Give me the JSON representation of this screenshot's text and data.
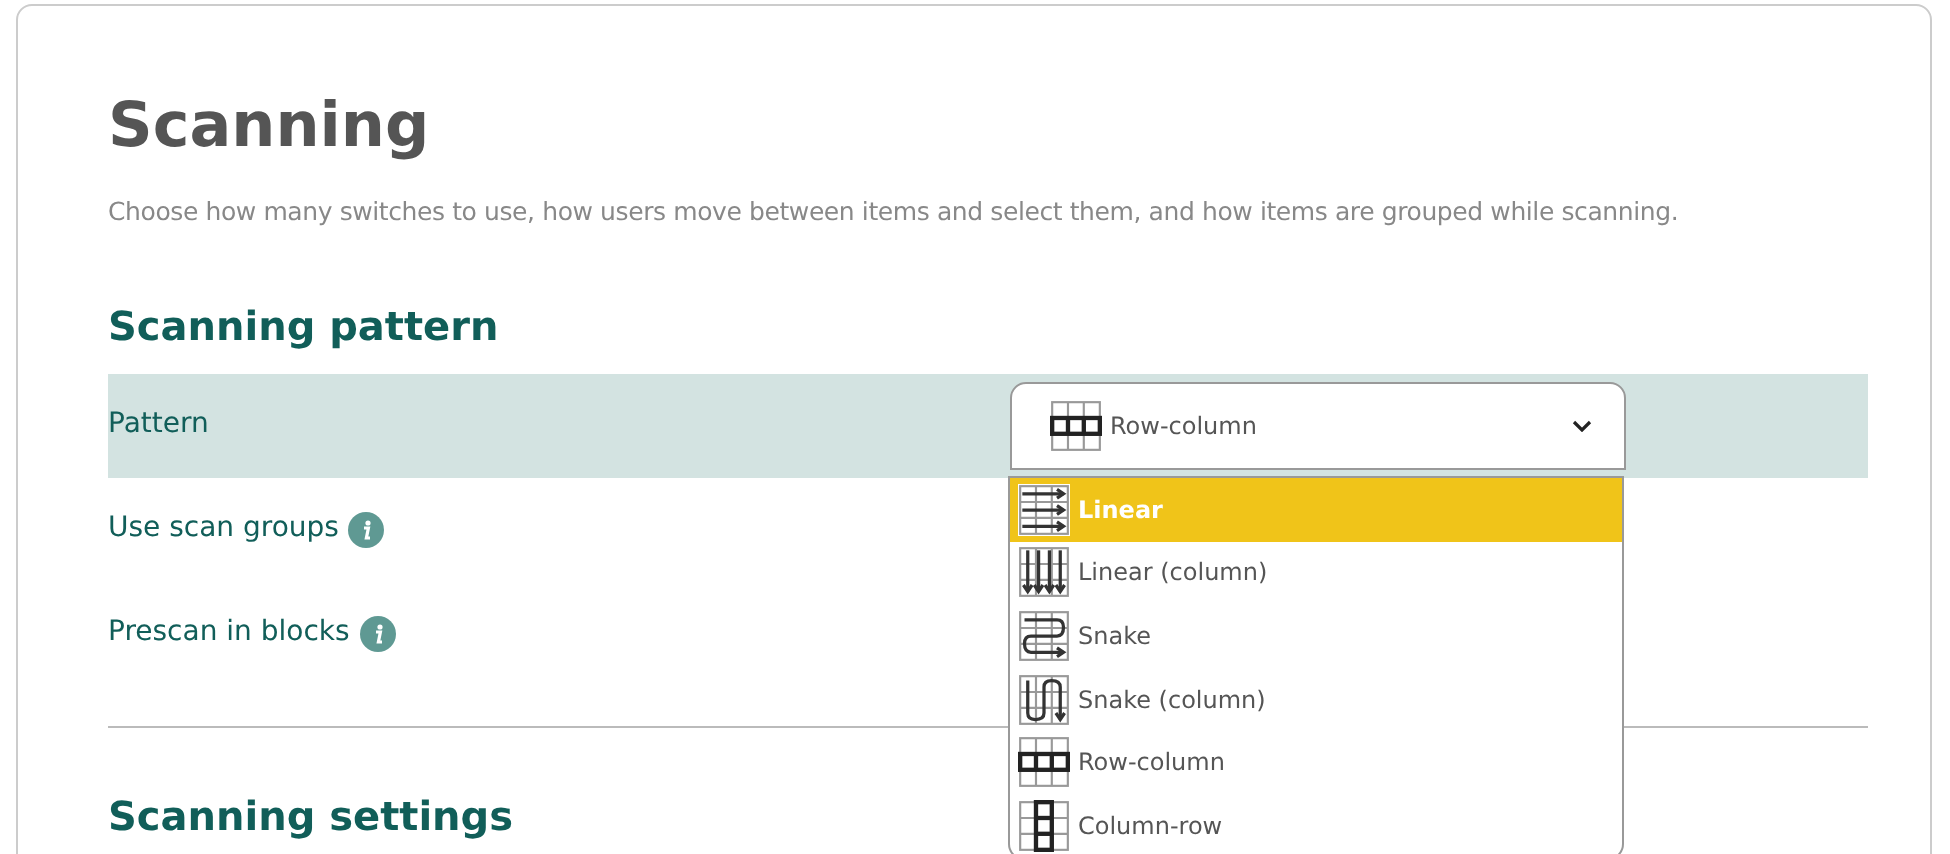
{
  "title": "Scanning",
  "description": "Choose how many switches to use, how users move between items and select them, and how items are grouped while scanning.",
  "section": "Scanning pattern",
  "rows": [
    {
      "label": "Pattern",
      "kind": "select",
      "highlighted": true
    },
    {
      "label": "Use scan groups",
      "kind": "info",
      "highlighted": false
    },
    {
      "label": "Prescan in blocks",
      "kind": "info",
      "highlighted": false
    }
  ],
  "select": {
    "value": "Row-column",
    "kind": "row-column",
    "expanded": true
  },
  "options": [
    {
      "label": "Linear",
      "kind": "linear",
      "selected": true
    },
    {
      "label": "Linear (column)",
      "kind": "linear-column",
      "selected": false
    },
    {
      "label": "Snake",
      "kind": "snake",
      "selected": false
    },
    {
      "label": "Snake (column)",
      "kind": "snake-column",
      "selected": false
    },
    {
      "label": "Row-column",
      "kind": "row-column",
      "selected": false
    },
    {
      "label": "Column-row",
      "kind": "column-row",
      "selected": false
    }
  ],
  "section_2": "Scanning settings"
}
